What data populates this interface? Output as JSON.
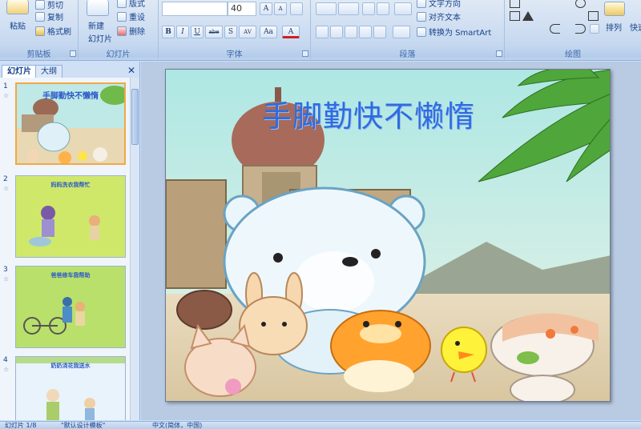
{
  "ribbon": {
    "clipboard": {
      "label": "剪贴板",
      "paste": "粘贴",
      "cut": "剪切",
      "copy": "复制",
      "format_painter": "格式刷"
    },
    "slides": {
      "label": "幻灯片",
      "new_slide_line1": "新建",
      "new_slide_line2": "幻灯片",
      "layout": "版式",
      "reset": "重设",
      "delete": "删除"
    },
    "font": {
      "label": "字体",
      "font_size": "40",
      "bold": "B",
      "italic": "I",
      "underline": "U",
      "strike": "abe",
      "shadow": "S",
      "spacing": "AV",
      "change_case": "Aa",
      "color": "A",
      "grow": "A",
      "shrink": "A"
    },
    "paragraph": {
      "label": "段落",
      "text_direction": "文字方向",
      "align_text": "对齐文本",
      "convert_smartart": "转换为 SmartArt"
    },
    "drawing": {
      "label": "绘图",
      "arrange": "排列",
      "quick_styles": "快速"
    }
  },
  "panel": {
    "tab_slides": "幻灯片",
    "tab_outline": "大纲",
    "close": "✕",
    "thumbnails": [
      {
        "num": "1",
        "title": "手脚勤快不懒惰"
      },
      {
        "num": "2",
        "title": "妈妈洗衣我帮忙"
      },
      {
        "num": "3",
        "title": "爸爸修车我帮助"
      },
      {
        "num": "4",
        "title": "奶奶浇花我送水"
      }
    ]
  },
  "slide": {
    "title": "手脚勤快不懒惰"
  },
  "status": {
    "slide_count": "幻灯片 1/8",
    "theme": "\"默认设计模板\"",
    "language": "中文(简体，中国)"
  }
}
